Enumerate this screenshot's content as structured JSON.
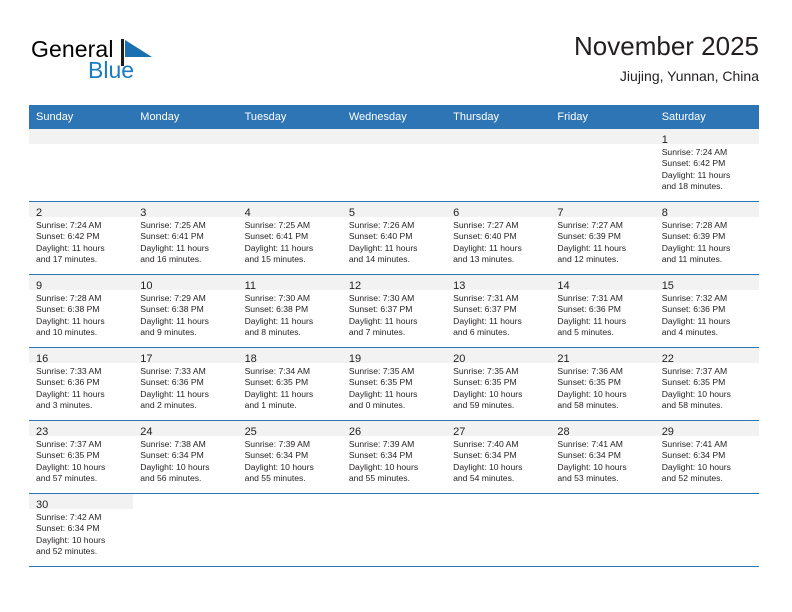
{
  "brand": {
    "name_top": "General",
    "name_bottom": "Blue",
    "flag_icon": "triangle-flag-icon",
    "color_black": "#000000",
    "color_blue": "#1a7dc4"
  },
  "header": {
    "title": "November 2025",
    "subtitle": "Jiujing, Yunnan, China"
  },
  "theme": {
    "header_row_bg": "#2e75b6",
    "daynum_band_bg": "#f2f2f2",
    "week_divider": "#2e75b6",
    "text": "#231f20"
  },
  "weekday_headers": [
    "Sunday",
    "Monday",
    "Tuesday",
    "Wednesday",
    "Thursday",
    "Friday",
    "Saturday"
  ],
  "weeks": [
    [
      {
        "day": "",
        "sunrise": "",
        "sunset": "",
        "daylight_1": "",
        "daylight_2": ""
      },
      {
        "day": "",
        "sunrise": "",
        "sunset": "",
        "daylight_1": "",
        "daylight_2": ""
      },
      {
        "day": "",
        "sunrise": "",
        "sunset": "",
        "daylight_1": "",
        "daylight_2": ""
      },
      {
        "day": "",
        "sunrise": "",
        "sunset": "",
        "daylight_1": "",
        "daylight_2": ""
      },
      {
        "day": "",
        "sunrise": "",
        "sunset": "",
        "daylight_1": "",
        "daylight_2": ""
      },
      {
        "day": "",
        "sunrise": "",
        "sunset": "",
        "daylight_1": "",
        "daylight_2": ""
      },
      {
        "day": "1",
        "sunrise": "Sunrise: 7:24 AM",
        "sunset": "Sunset: 6:42 PM",
        "daylight_1": "Daylight: 11 hours",
        "daylight_2": "and 18 minutes."
      }
    ],
    [
      {
        "day": "2",
        "sunrise": "Sunrise: 7:24 AM",
        "sunset": "Sunset: 6:42 PM",
        "daylight_1": "Daylight: 11 hours",
        "daylight_2": "and 17 minutes."
      },
      {
        "day": "3",
        "sunrise": "Sunrise: 7:25 AM",
        "sunset": "Sunset: 6:41 PM",
        "daylight_1": "Daylight: 11 hours",
        "daylight_2": "and 16 minutes."
      },
      {
        "day": "4",
        "sunrise": "Sunrise: 7:25 AM",
        "sunset": "Sunset: 6:41 PM",
        "daylight_1": "Daylight: 11 hours",
        "daylight_2": "and 15 minutes."
      },
      {
        "day": "5",
        "sunrise": "Sunrise: 7:26 AM",
        "sunset": "Sunset: 6:40 PM",
        "daylight_1": "Daylight: 11 hours",
        "daylight_2": "and 14 minutes."
      },
      {
        "day": "6",
        "sunrise": "Sunrise: 7:27 AM",
        "sunset": "Sunset: 6:40 PM",
        "daylight_1": "Daylight: 11 hours",
        "daylight_2": "and 13 minutes."
      },
      {
        "day": "7",
        "sunrise": "Sunrise: 7:27 AM",
        "sunset": "Sunset: 6:39 PM",
        "daylight_1": "Daylight: 11 hours",
        "daylight_2": "and 12 minutes."
      },
      {
        "day": "8",
        "sunrise": "Sunrise: 7:28 AM",
        "sunset": "Sunset: 6:39 PM",
        "daylight_1": "Daylight: 11 hours",
        "daylight_2": "and 11 minutes."
      }
    ],
    [
      {
        "day": "9",
        "sunrise": "Sunrise: 7:28 AM",
        "sunset": "Sunset: 6:38 PM",
        "daylight_1": "Daylight: 11 hours",
        "daylight_2": "and 10 minutes."
      },
      {
        "day": "10",
        "sunrise": "Sunrise: 7:29 AM",
        "sunset": "Sunset: 6:38 PM",
        "daylight_1": "Daylight: 11 hours",
        "daylight_2": "and 9 minutes."
      },
      {
        "day": "11",
        "sunrise": "Sunrise: 7:30 AM",
        "sunset": "Sunset: 6:38 PM",
        "daylight_1": "Daylight: 11 hours",
        "daylight_2": "and 8 minutes."
      },
      {
        "day": "12",
        "sunrise": "Sunrise: 7:30 AM",
        "sunset": "Sunset: 6:37 PM",
        "daylight_1": "Daylight: 11 hours",
        "daylight_2": "and 7 minutes."
      },
      {
        "day": "13",
        "sunrise": "Sunrise: 7:31 AM",
        "sunset": "Sunset: 6:37 PM",
        "daylight_1": "Daylight: 11 hours",
        "daylight_2": "and 6 minutes."
      },
      {
        "day": "14",
        "sunrise": "Sunrise: 7:31 AM",
        "sunset": "Sunset: 6:36 PM",
        "daylight_1": "Daylight: 11 hours",
        "daylight_2": "and 5 minutes."
      },
      {
        "day": "15",
        "sunrise": "Sunrise: 7:32 AM",
        "sunset": "Sunset: 6:36 PM",
        "daylight_1": "Daylight: 11 hours",
        "daylight_2": "and 4 minutes."
      }
    ],
    [
      {
        "day": "16",
        "sunrise": "Sunrise: 7:33 AM",
        "sunset": "Sunset: 6:36 PM",
        "daylight_1": "Daylight: 11 hours",
        "daylight_2": "and 3 minutes."
      },
      {
        "day": "17",
        "sunrise": "Sunrise: 7:33 AM",
        "sunset": "Sunset: 6:36 PM",
        "daylight_1": "Daylight: 11 hours",
        "daylight_2": "and 2 minutes."
      },
      {
        "day": "18",
        "sunrise": "Sunrise: 7:34 AM",
        "sunset": "Sunset: 6:35 PM",
        "daylight_1": "Daylight: 11 hours",
        "daylight_2": "and 1 minute."
      },
      {
        "day": "19",
        "sunrise": "Sunrise: 7:35 AM",
        "sunset": "Sunset: 6:35 PM",
        "daylight_1": "Daylight: 11 hours",
        "daylight_2": "and 0 minutes."
      },
      {
        "day": "20",
        "sunrise": "Sunrise: 7:35 AM",
        "sunset": "Sunset: 6:35 PM",
        "daylight_1": "Daylight: 10 hours",
        "daylight_2": "and 59 minutes."
      },
      {
        "day": "21",
        "sunrise": "Sunrise: 7:36 AM",
        "sunset": "Sunset: 6:35 PM",
        "daylight_1": "Daylight: 10 hours",
        "daylight_2": "and 58 minutes."
      },
      {
        "day": "22",
        "sunrise": "Sunrise: 7:37 AM",
        "sunset": "Sunset: 6:35 PM",
        "daylight_1": "Daylight: 10 hours",
        "daylight_2": "and 58 minutes."
      }
    ],
    [
      {
        "day": "23",
        "sunrise": "Sunrise: 7:37 AM",
        "sunset": "Sunset: 6:35 PM",
        "daylight_1": "Daylight: 10 hours",
        "daylight_2": "and 57 minutes."
      },
      {
        "day": "24",
        "sunrise": "Sunrise: 7:38 AM",
        "sunset": "Sunset: 6:34 PM",
        "daylight_1": "Daylight: 10 hours",
        "daylight_2": "and 56 minutes."
      },
      {
        "day": "25",
        "sunrise": "Sunrise: 7:39 AM",
        "sunset": "Sunset: 6:34 PM",
        "daylight_1": "Daylight: 10 hours",
        "daylight_2": "and 55 minutes."
      },
      {
        "day": "26",
        "sunrise": "Sunrise: 7:39 AM",
        "sunset": "Sunset: 6:34 PM",
        "daylight_1": "Daylight: 10 hours",
        "daylight_2": "and 55 minutes."
      },
      {
        "day": "27",
        "sunrise": "Sunrise: 7:40 AM",
        "sunset": "Sunset: 6:34 PM",
        "daylight_1": "Daylight: 10 hours",
        "daylight_2": "and 54 minutes."
      },
      {
        "day": "28",
        "sunrise": "Sunrise: 7:41 AM",
        "sunset": "Sunset: 6:34 PM",
        "daylight_1": "Daylight: 10 hours",
        "daylight_2": "and 53 minutes."
      },
      {
        "day": "29",
        "sunrise": "Sunrise: 7:41 AM",
        "sunset": "Sunset: 6:34 PM",
        "daylight_1": "Daylight: 10 hours",
        "daylight_2": "and 52 minutes."
      }
    ],
    [
      {
        "day": "30",
        "sunrise": "Sunrise: 7:42 AM",
        "sunset": "Sunset: 6:34 PM",
        "daylight_1": "Daylight: 10 hours",
        "daylight_2": "and 52 minutes."
      },
      {
        "day": "",
        "sunrise": "",
        "sunset": "",
        "daylight_1": "",
        "daylight_2": ""
      },
      {
        "day": "",
        "sunrise": "",
        "sunset": "",
        "daylight_1": "",
        "daylight_2": ""
      },
      {
        "day": "",
        "sunrise": "",
        "sunset": "",
        "daylight_1": "",
        "daylight_2": ""
      },
      {
        "day": "",
        "sunrise": "",
        "sunset": "",
        "daylight_1": "",
        "daylight_2": ""
      },
      {
        "day": "",
        "sunrise": "",
        "sunset": "",
        "daylight_1": "",
        "daylight_2": ""
      },
      {
        "day": "",
        "sunrise": "",
        "sunset": "",
        "daylight_1": "",
        "daylight_2": ""
      }
    ]
  ]
}
